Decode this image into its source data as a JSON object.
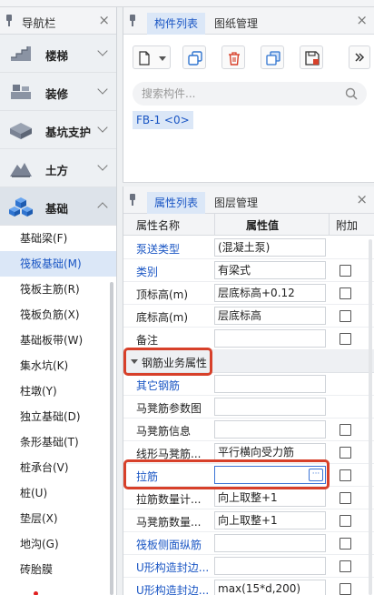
{
  "nav": {
    "title": "导航栏",
    "categories": [
      {
        "label": "楼梯"
      },
      {
        "label": "装修"
      },
      {
        "label": "基坑支护"
      },
      {
        "label": "土方"
      },
      {
        "label": "基础"
      }
    ],
    "items": [
      {
        "label": "基础梁(F)"
      },
      {
        "label": "筏板基础(M)"
      },
      {
        "label": "筏板主筋(R)"
      },
      {
        "label": "筏板负筋(X)"
      },
      {
        "label": "基础板带(W)"
      },
      {
        "label": "集水坑(K)"
      },
      {
        "label": "柱墩(Y)"
      },
      {
        "label": "独立基础(D)"
      },
      {
        "label": "条形基础(T)"
      },
      {
        "label": "桩承台(V)"
      },
      {
        "label": "桩(U)"
      },
      {
        "label": "垫层(X)"
      },
      {
        "label": "地沟(G)"
      },
      {
        "label": "砖胎膜"
      }
    ]
  },
  "component_panel": {
    "tabs": [
      {
        "label": "构件列表"
      },
      {
        "label": "图纸管理"
      }
    ],
    "search_placeholder": "搜索构件...",
    "selected_component": "FB-1 <0>"
  },
  "property_panel": {
    "tabs": [
      {
        "label": "属性列表"
      },
      {
        "label": "图层管理"
      }
    ],
    "columns": {
      "name": "属性名称",
      "value": "属性值",
      "extra": "附加"
    },
    "rows": [
      {
        "name": "泵送类型",
        "value": "(混凝土泵)",
        "link": true,
        "checkbox": false
      },
      {
        "name": "类别",
        "value": "有梁式",
        "link": true,
        "checkbox": true
      },
      {
        "name": "顶标高(m)",
        "value": "层底标高+0.12",
        "link": false,
        "checkbox": true
      },
      {
        "name": "底标高(m)",
        "value": "层底标高",
        "link": false,
        "checkbox": true
      },
      {
        "name": "备注",
        "value": "",
        "link": false,
        "checkbox": true
      }
    ],
    "group_label": "钢筋业务属性",
    "group_rows": [
      {
        "name": "其它钢筋",
        "value": "",
        "link": true,
        "checkbox": false
      },
      {
        "name": "马凳筋参数图",
        "value": "",
        "link": false,
        "checkbox": false
      },
      {
        "name": "马凳筋信息",
        "value": "",
        "link": false,
        "checkbox": true
      },
      {
        "name": "线形马凳筋...",
        "value": "平行横向受力筋",
        "link": false,
        "checkbox": true
      },
      {
        "name": "拉筋",
        "value": "",
        "link": true,
        "checkbox": true,
        "editing": true
      },
      {
        "name": "拉筋数量计...",
        "value": "向上取整+1",
        "link": false,
        "checkbox": true
      },
      {
        "name": "马凳筋数量...",
        "value": "向上取整+1",
        "link": false,
        "checkbox": true
      },
      {
        "name": "筏板侧面纵筋",
        "value": "",
        "link": true,
        "checkbox": true
      },
      {
        "name": "U形构造封边...",
        "value": "",
        "link": true,
        "checkbox": true
      },
      {
        "name": "U形构造封边...",
        "value": "max(15*d,200)",
        "link": true,
        "checkbox": true
      }
    ]
  },
  "colors": {
    "accent": "#1a56c4",
    "highlight": "#d7402a",
    "selected_bg": "#dbe7f7"
  }
}
